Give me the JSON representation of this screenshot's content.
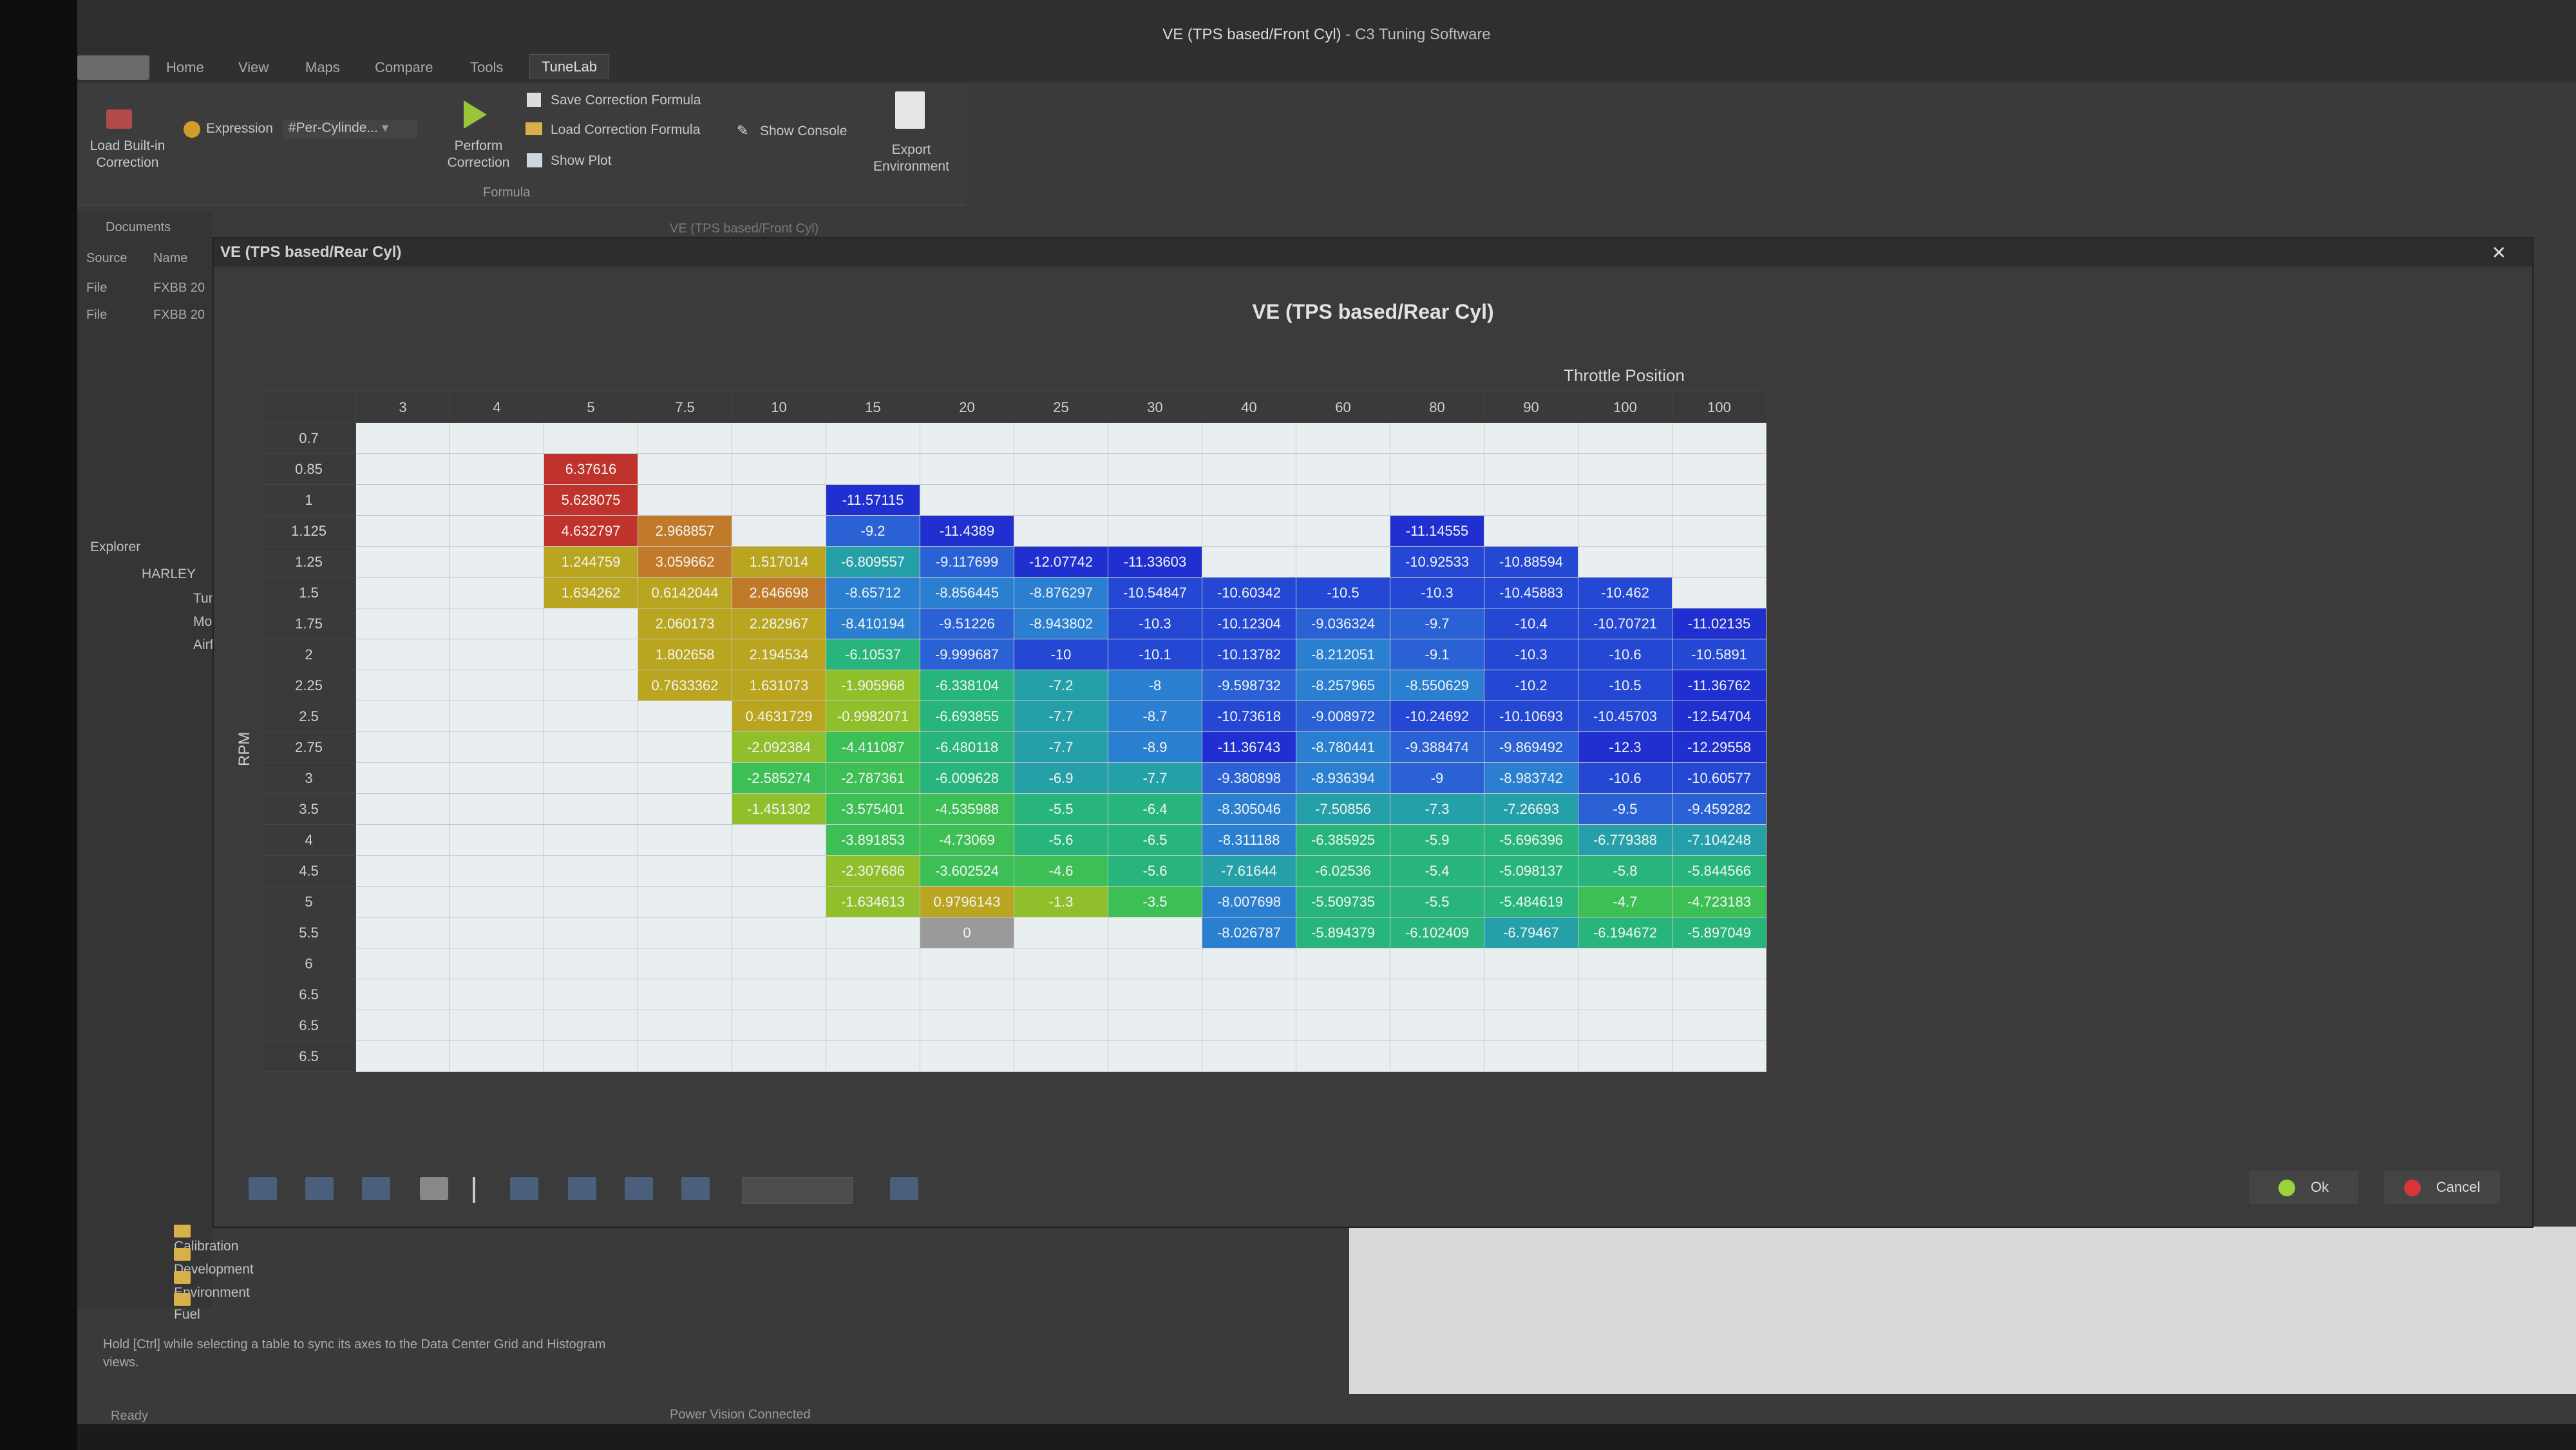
{
  "window": {
    "title": "VE (TPS based/Front Cyl)",
    "app": " - C3 Tuning Software"
  },
  "menu": {
    "tabs": [
      "Home",
      "View",
      "Maps",
      "Compare",
      "Tools",
      "TuneLab"
    ],
    "active": "TuneLab"
  },
  "ribbon": {
    "load_builtin": "Load Built-in Correction",
    "expression_label": "Expression",
    "expression_value": "#Per-Cylinde...",
    "perform": "Perform Correction",
    "save_formula": "Save Correction Formula",
    "load_formula": "Load Correction Formula",
    "show_plot": "Show Plot",
    "show_console": "Show Console",
    "export": "Export Environment",
    "group": "Formula"
  },
  "documents": {
    "title": "Documents",
    "tab": "VE (TPS based/Front Cyl)",
    "columns": [
      "Source",
      "Name"
    ],
    "rows": [
      [
        "File",
        "FXBB 20"
      ],
      [
        "File",
        "FXBB 20"
      ]
    ]
  },
  "explorer": {
    "title": "Explorer",
    "items": [
      "HARLEY",
      "Tun",
      "Mor",
      "Airf",
      "Calibration",
      "Development",
      "Environment",
      "Fuel"
    ]
  },
  "dialog": {
    "window_title": "VE (TPS based/Rear Cyl)",
    "heading": "VE (TPS based/Rear Cyl)",
    "x_axis": "Throttle Position",
    "y_axis": "RPM",
    "ok": "Ok",
    "cancel": "Cancel"
  },
  "grid": {
    "columns": [
      "3",
      "4",
      "5",
      "7.5",
      "10",
      "15",
      "20",
      "25",
      "30",
      "40",
      "60",
      "80",
      "90",
      "100",
      "100"
    ],
    "rows": [
      "0.7",
      "0.85",
      "1",
      "1.125",
      "1.25",
      "1.5",
      "1.75",
      "2",
      "2.25",
      "2.5",
      "2.75",
      "3",
      "3.5",
      "4",
      "4.5",
      "5",
      "5.5",
      "6",
      "6.5",
      "6.5",
      "6.5"
    ],
    "cells": [
      [
        "",
        "",
        "",
        "",
        "",
        "",
        "",
        "",
        "",
        "",
        "",
        "",
        "",
        "",
        ""
      ],
      [
        "",
        "",
        "6.37616",
        "",
        "",
        "",
        "",
        "",
        "",
        "",
        "",
        "",
        "",
        "",
        ""
      ],
      [
        "",
        "",
        "5.628075",
        "",
        "",
        "-11.57115",
        "",
        "",
        "",
        "",
        "",
        "",
        "",
        "",
        ""
      ],
      [
        "",
        "",
        "4.632797",
        "2.968857",
        "",
        "-9.2",
        "-11.4389",
        "",
        "",
        "",
        "",
        "-11.14555",
        "",
        "",
        ""
      ],
      [
        "",
        "",
        "1.244759",
        "3.059662",
        "1.517014",
        "-6.809557",
        "-9.117699",
        "-12.07742",
        "-11.33603",
        "",
        "",
        "-10.92533",
        "-10.88594",
        "",
        ""
      ],
      [
        "",
        "",
        "1.634262",
        "0.6142044",
        "2.646698",
        "-8.65712",
        "-8.856445",
        "-8.876297",
        "-10.54847",
        "-10.60342",
        "-10.5",
        "-10.3",
        "-10.45883",
        "-10.462",
        ""
      ],
      [
        "",
        "",
        "",
        "2.060173",
        "2.282967",
        "-8.410194",
        "-9.51226",
        "-8.943802",
        "-10.3",
        "-10.12304",
        "-9.036324",
        "-9.7",
        "-10.4",
        "-10.70721",
        "-11.02135"
      ],
      [
        "",
        "",
        "",
        "1.802658",
        "2.194534",
        "-6.10537",
        "-9.999687",
        "-10",
        "-10.1",
        "-10.13782",
        "-8.212051",
        "-9.1",
        "-10.3",
        "-10.6",
        "-10.5891"
      ],
      [
        "",
        "",
        "",
        "0.7633362",
        "1.631073",
        "-1.905968",
        "-6.338104",
        "-7.2",
        "-8",
        "-9.598732",
        "-8.257965",
        "-8.550629",
        "-10.2",
        "-10.5",
        "-11.36762"
      ],
      [
        "",
        "",
        "",
        "",
        "0.4631729",
        "-0.9982071",
        "-6.693855",
        "-7.7",
        "-8.7",
        "-10.73618",
        "-9.008972",
        "-10.24692",
        "-10.10693",
        "-10.45703",
        "-12.54704"
      ],
      [
        "",
        "",
        "",
        "",
        "-2.092384",
        "-4.411087",
        "-6.480118",
        "-7.7",
        "-8.9",
        "-11.36743",
        "-8.780441",
        "-9.388474",
        "-9.869492",
        "-12.3",
        "-12.29558"
      ],
      [
        "",
        "",
        "",
        "",
        "-2.585274",
        "-2.787361",
        "-6.009628",
        "-6.9",
        "-7.7",
        "-9.380898",
        "-8.936394",
        "-9",
        "-8.983742",
        "-10.6",
        "-10.60577"
      ],
      [
        "",
        "",
        "",
        "",
        "-1.451302",
        "-3.575401",
        "-4.535988",
        "-5.5",
        "-6.4",
        "-8.305046",
        "-7.50856",
        "-7.3",
        "-7.26693",
        "-9.5",
        "-9.459282"
      ],
      [
        "",
        "",
        "",
        "",
        "",
        "-3.891853",
        "-4.73069",
        "-5.6",
        "-6.5",
        "-8.311188",
        "-6.385925",
        "-5.9",
        "-5.696396",
        "-6.779388",
        "-7.104248"
      ],
      [
        "",
        "",
        "",
        "",
        "",
        "-2.307686",
        "-3.602524",
        "-4.6",
        "-5.6",
        "-7.61644",
        "-6.02536",
        "-5.4",
        "-5.098137",
        "-5.8",
        "-5.844566"
      ],
      [
        "",
        "",
        "",
        "",
        "",
        "-1.634613",
        "0.9796143",
        "-1.3",
        "-3.5",
        "-8.007698",
        "-5.509735",
        "-5.5",
        "-5.484619",
        "-4.7",
        "-4.723183"
      ],
      [
        "",
        "",
        "",
        "",
        "",
        "",
        "0",
        "",
        "",
        "-8.026787",
        "-5.894379",
        "-6.102409",
        "-6.79467",
        "-6.194672",
        "-5.897049"
      ],
      [
        "",
        "",
        "",
        "",
        "",
        "",
        "",
        "",
        "",
        "",
        "",
        "",
        "",
        "",
        ""
      ],
      [
        "",
        "",
        "",
        "",
        "",
        "",
        "",
        "",
        "",
        "",
        "",
        "",
        "",
        "",
        ""
      ],
      [
        "",
        "",
        "",
        "",
        "",
        "",
        "",
        "",
        "",
        "",
        "",
        "",
        "",
        "",
        ""
      ],
      [
        "",
        "",
        "",
        "",
        "",
        "",
        "",
        "",
        "",
        "",
        "",
        "",
        "",
        "",
        ""
      ]
    ]
  },
  "status": {
    "hint": "Hold [Ctrl] while selecting a table to sync its axes to the Data Center Grid and Histogram views.",
    "ready": "Ready",
    "power_vision": "Power Vision Connected"
  },
  "colors": {
    "positive_high": "#c0322c",
    "positive_mid": "#b9a51f",
    "negative_low": "#27b56e",
    "negative_high": "#1f2fd0",
    "empty": "#e9eef0"
  }
}
